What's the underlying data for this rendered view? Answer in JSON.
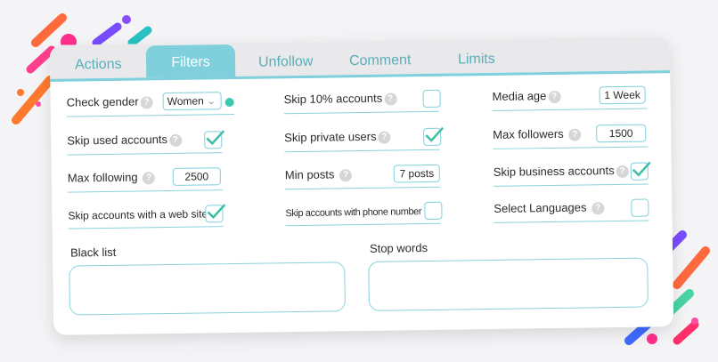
{
  "tabs": [
    "Actions",
    "Filters",
    "Unfollow",
    "Comment",
    "Limits"
  ],
  "active_tab": "Filters",
  "help_glyph": "?",
  "filters": {
    "check_gender": {
      "label": "Check gender",
      "value": "Women",
      "caret": "⌄"
    },
    "skip_10_percent": {
      "label": "Skip 10% accounts",
      "checked": false
    },
    "media_age": {
      "label": "Media age",
      "value": "1 Week"
    },
    "skip_used": {
      "label": "Skip used accounts",
      "checked": true
    },
    "skip_private": {
      "label": "Skip private users",
      "checked": true
    },
    "max_followers": {
      "label": "Max followers",
      "value": "1500"
    },
    "max_following": {
      "label": "Max following",
      "value": "2500"
    },
    "min_posts": {
      "label": "Min posts",
      "value": "7 posts"
    },
    "skip_business": {
      "label": "Skip business accounts",
      "checked": true
    },
    "skip_web_site": {
      "label": "Skip accounts with a web site",
      "checked": true
    },
    "skip_phone": {
      "label": "Skip accounts with phone number",
      "checked": false
    },
    "select_languages": {
      "label": "Select Languages",
      "checked": false
    }
  },
  "black_list": {
    "label": "Black list",
    "value": ""
  },
  "stop_words": {
    "label": "Stop words",
    "value": ""
  },
  "colors": {
    "accent": "#7fcfdc",
    "tab_text": "#5aaeb9",
    "check": "#3cbfa8"
  }
}
